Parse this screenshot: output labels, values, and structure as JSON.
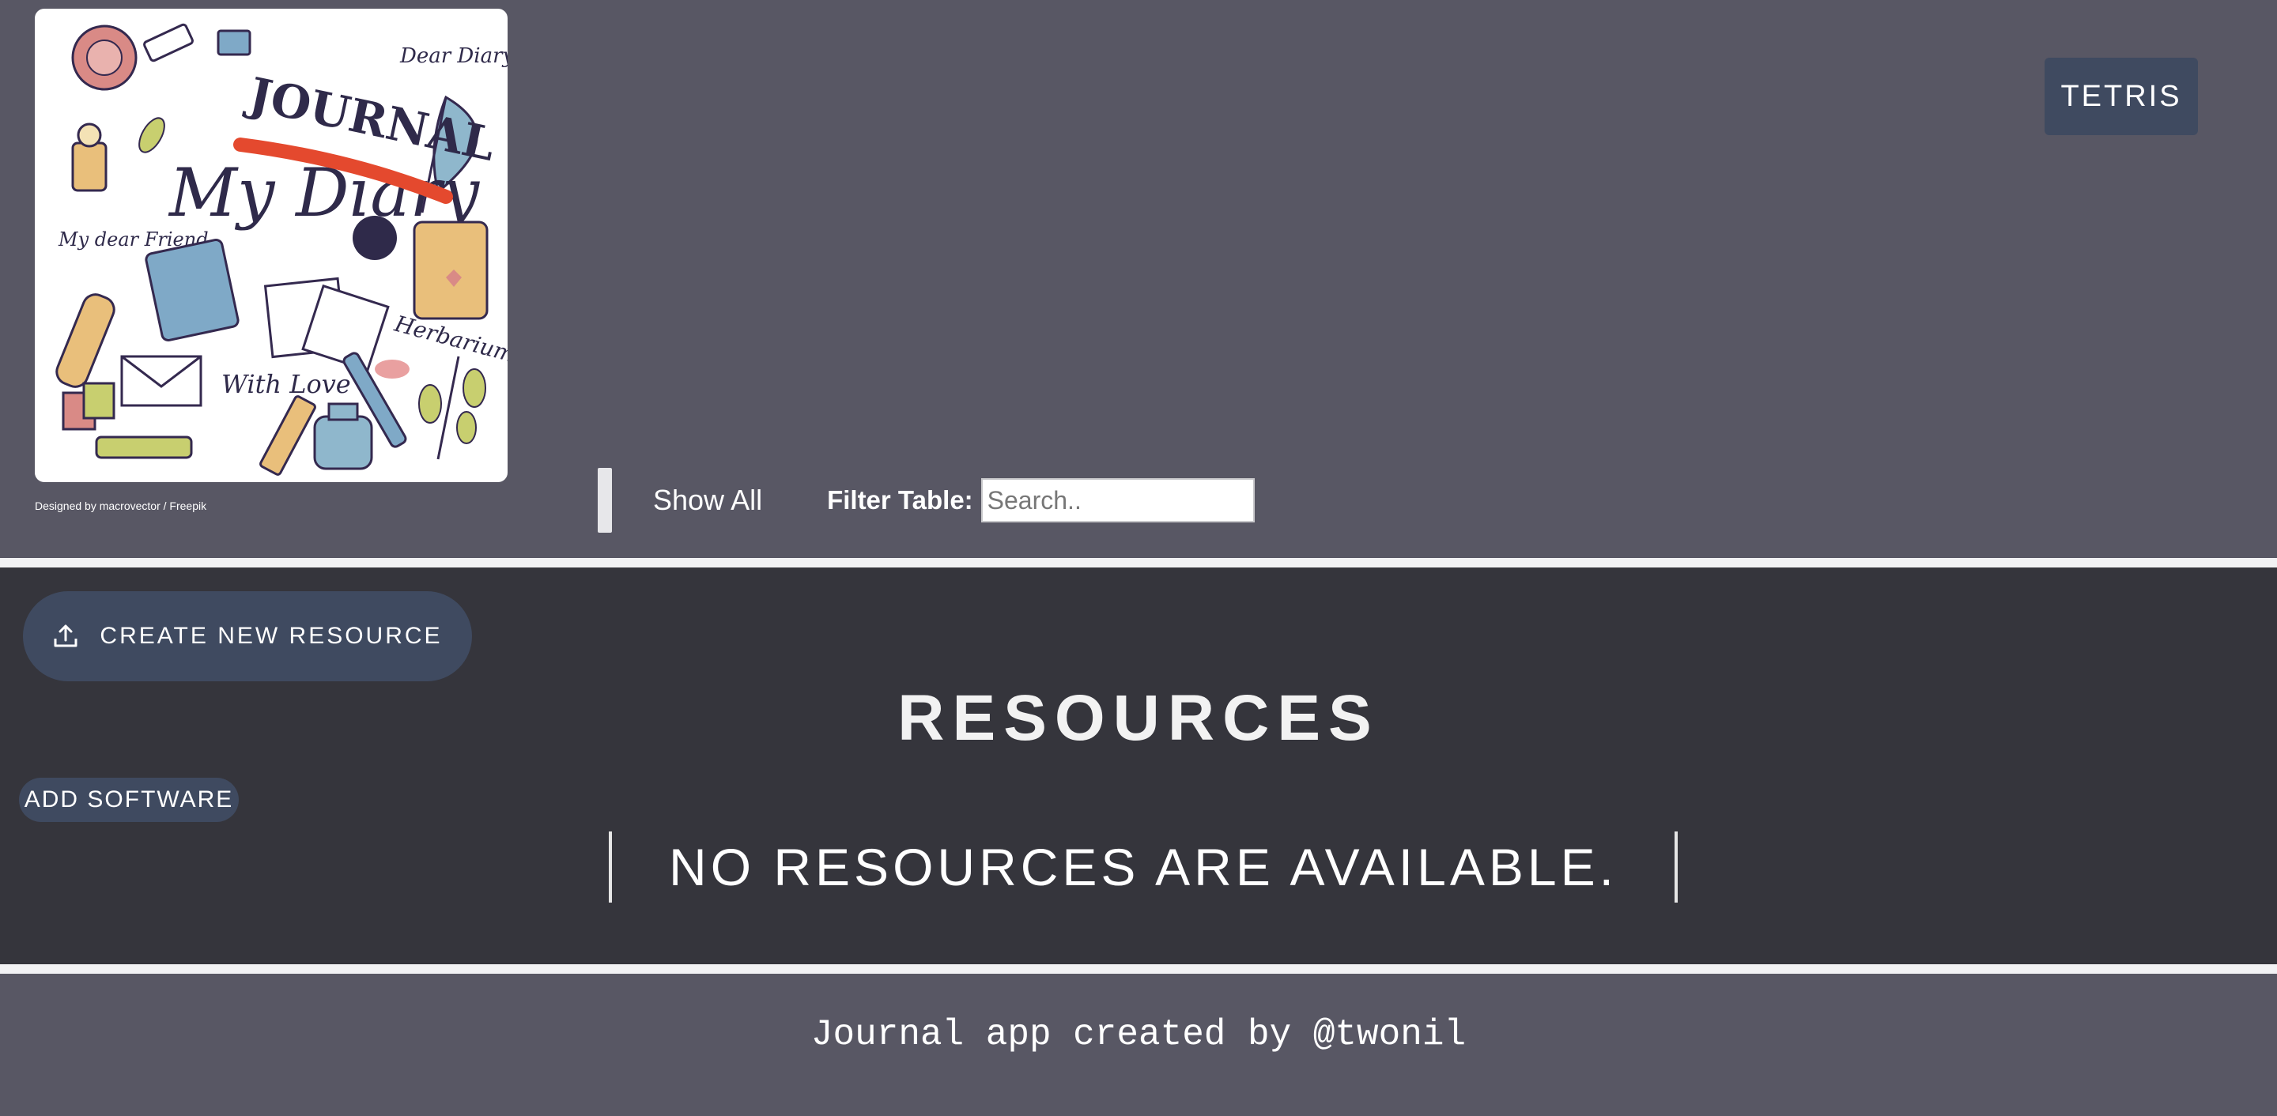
{
  "header": {
    "logo_alt": "Journal doodle illustration",
    "logo_text": {
      "journal": "JOURNAL",
      "my_diary": "My Diary",
      "dear_diary": "Dear Diary",
      "my_dear_friend": "My dear Friend",
      "with_love": "With Love",
      "herbarium": "Herbarium"
    },
    "credit": "Designed by macrovector / Freepik",
    "tetris_label": "TETRIS",
    "show_all_label": "Show All",
    "filter_label": "Filter Table:",
    "search_placeholder": "Search.."
  },
  "main": {
    "create_label": "CREATE NEW RESOURCE",
    "title": "RESOURCES",
    "add_software_label": "ADD SOFTWARE",
    "empty_message": "NO RESOURCES ARE AVAILABLE."
  },
  "footer": {
    "text": "Journal app created by @twonil"
  },
  "colors": {
    "header_bg": "#585764",
    "main_bg": "#35353c",
    "button_bg": "#3f4a60",
    "divider": "#f2f2f4"
  }
}
